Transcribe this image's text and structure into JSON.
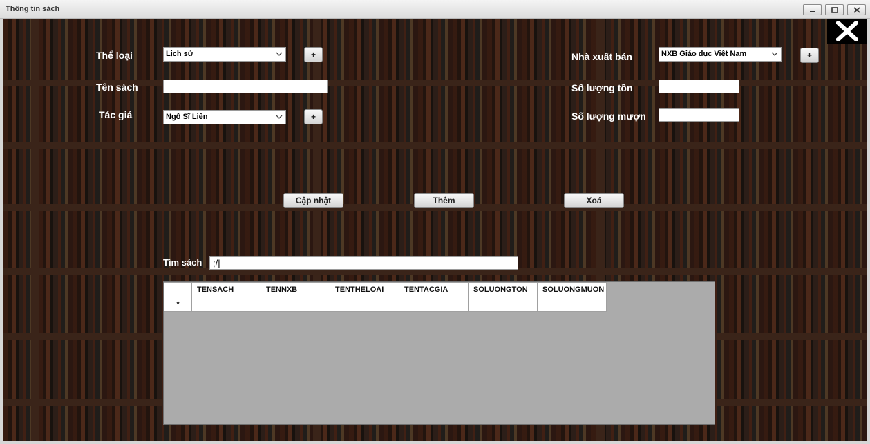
{
  "window": {
    "title": "Thông tin sách",
    "controls": [
      "minimize",
      "maximize",
      "close"
    ]
  },
  "form": {
    "category_label": "Thể loại",
    "category_value": "Lịch sử",
    "category_add": "+",
    "title_label": "Tên sách",
    "title_value": "",
    "author_label": "Tác giả",
    "author_value": "Ngô Sĩ Liên",
    "author_add": "+",
    "publisher_label": "Nhà xuất bản",
    "publisher_value": "NXB Giáo dục Việt Nam",
    "publisher_add": "+",
    "stock_label": "Số lượng tồn",
    "stock_value": "",
    "borrowed_label": "Số lượng mượn",
    "borrowed_value": ""
  },
  "actions": {
    "update": "Cập nhật",
    "add": "Thêm",
    "delete": "Xoá"
  },
  "search": {
    "label": "Tìm sách",
    "value": ";/|"
  },
  "grid": {
    "columns": [
      "TENSACH",
      "TENNXB",
      "TENTHELOAI",
      "TENTACGIA",
      "SOLUONGTON",
      "SOLUONGMUON"
    ],
    "new_row_marker": "*",
    "rows": []
  },
  "icons": {
    "close_app": "close-x-icon",
    "combo_arrow": "chevron-down-icon"
  }
}
